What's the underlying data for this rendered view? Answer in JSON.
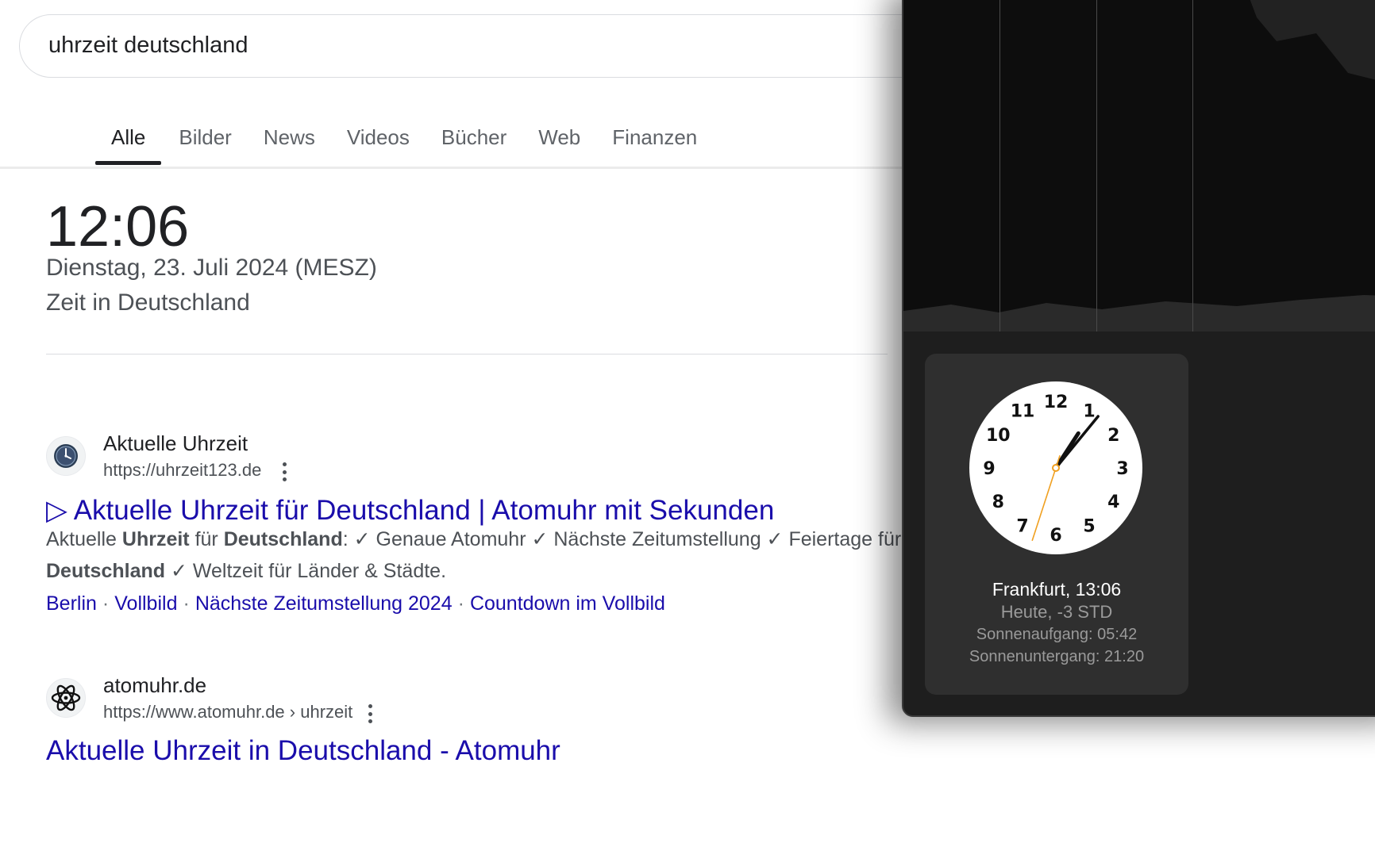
{
  "search": {
    "query": "uhrzeit deutschland"
  },
  "tabs": [
    {
      "label": "Alle",
      "active": true
    },
    {
      "label": "Bilder"
    },
    {
      "label": "News"
    },
    {
      "label": "Videos"
    },
    {
      "label": "Bücher"
    },
    {
      "label": "Web"
    },
    {
      "label": "Finanzen"
    }
  ],
  "time_widget": {
    "time": "12:06",
    "date": "Dienstag, 23. Juli 2024 (MESZ)",
    "zone": "Zeit in Deutschland"
  },
  "results": [
    {
      "site_name": "Aktuelle Uhrzeit",
      "url": "https://uhrzeit123.de",
      "favicon": "clock-icon",
      "title": "▷ Aktuelle Uhrzeit für Deutschland | Atomuhr mit Sekunden",
      "snippet_parts": [
        "Aktuelle ",
        "Uhrzeit",
        " für ",
        "Deutschland",
        ": ✓ Genaue Atomuhr ✓ Nächste Zeitumstellung ✓ Feiertage für",
        "Deutschland",
        " ✓ Weltzeit für Länder & Städte."
      ],
      "sitelinks": [
        "Berlin",
        "Vollbild",
        "Nächste Zeitumstellung 2024",
        "Countdown im Vollbild"
      ]
    },
    {
      "site_name": "atomuhr.de",
      "url": "https://www.atomuhr.de › uhrzeit",
      "favicon": "atom-icon",
      "title": "Aktuelle Uhrzeit in Deutschland - Atomuhr"
    }
  ],
  "world_clock": {
    "city_time": "Frankfurt, 13:06",
    "relative": "Heute, -3 STD",
    "sunrise": "Sonnenaufgang: 05:42",
    "sunset": "Sonnenuntergang: 21:20",
    "dial_numbers": [
      "12",
      "1",
      "2",
      "3",
      "4",
      "5",
      "6",
      "7",
      "8",
      "9",
      "10",
      "11"
    ],
    "hands": {
      "hour": 1,
      "minute": 6,
      "second": 33
    },
    "colors": {
      "panel": "#1e1e1e",
      "card": "#2f2f2f",
      "dial": "#ffffff",
      "second_hand": "#f0a020"
    }
  }
}
